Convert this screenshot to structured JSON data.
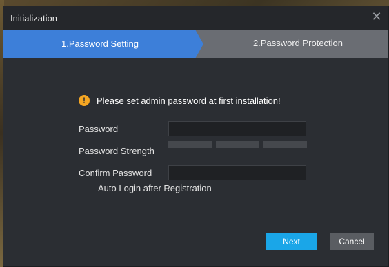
{
  "window": {
    "title": "Initialization",
    "close_icon": "close-icon"
  },
  "steps": [
    {
      "label": "1.Password Setting",
      "active": true
    },
    {
      "label": "2.Password Protection",
      "active": false
    }
  ],
  "notice": {
    "icon": "warning-icon",
    "text": "Please set admin password at first installation!"
  },
  "form": {
    "password_label": "Password",
    "password_value": "",
    "strength_label": "Password Strength",
    "confirm_label": "Confirm Password",
    "confirm_value": "",
    "auto_login_label": "Auto Login after Registration",
    "auto_login_checked": false
  },
  "buttons": {
    "next": "Next",
    "cancel": "Cancel"
  },
  "colors": {
    "active_step": "#3d7fd9",
    "inactive_step": "#6a6d73",
    "primary_button": "#1aa6e8",
    "warning": "#f5a623",
    "dialog_bg": "#2b2e33"
  }
}
